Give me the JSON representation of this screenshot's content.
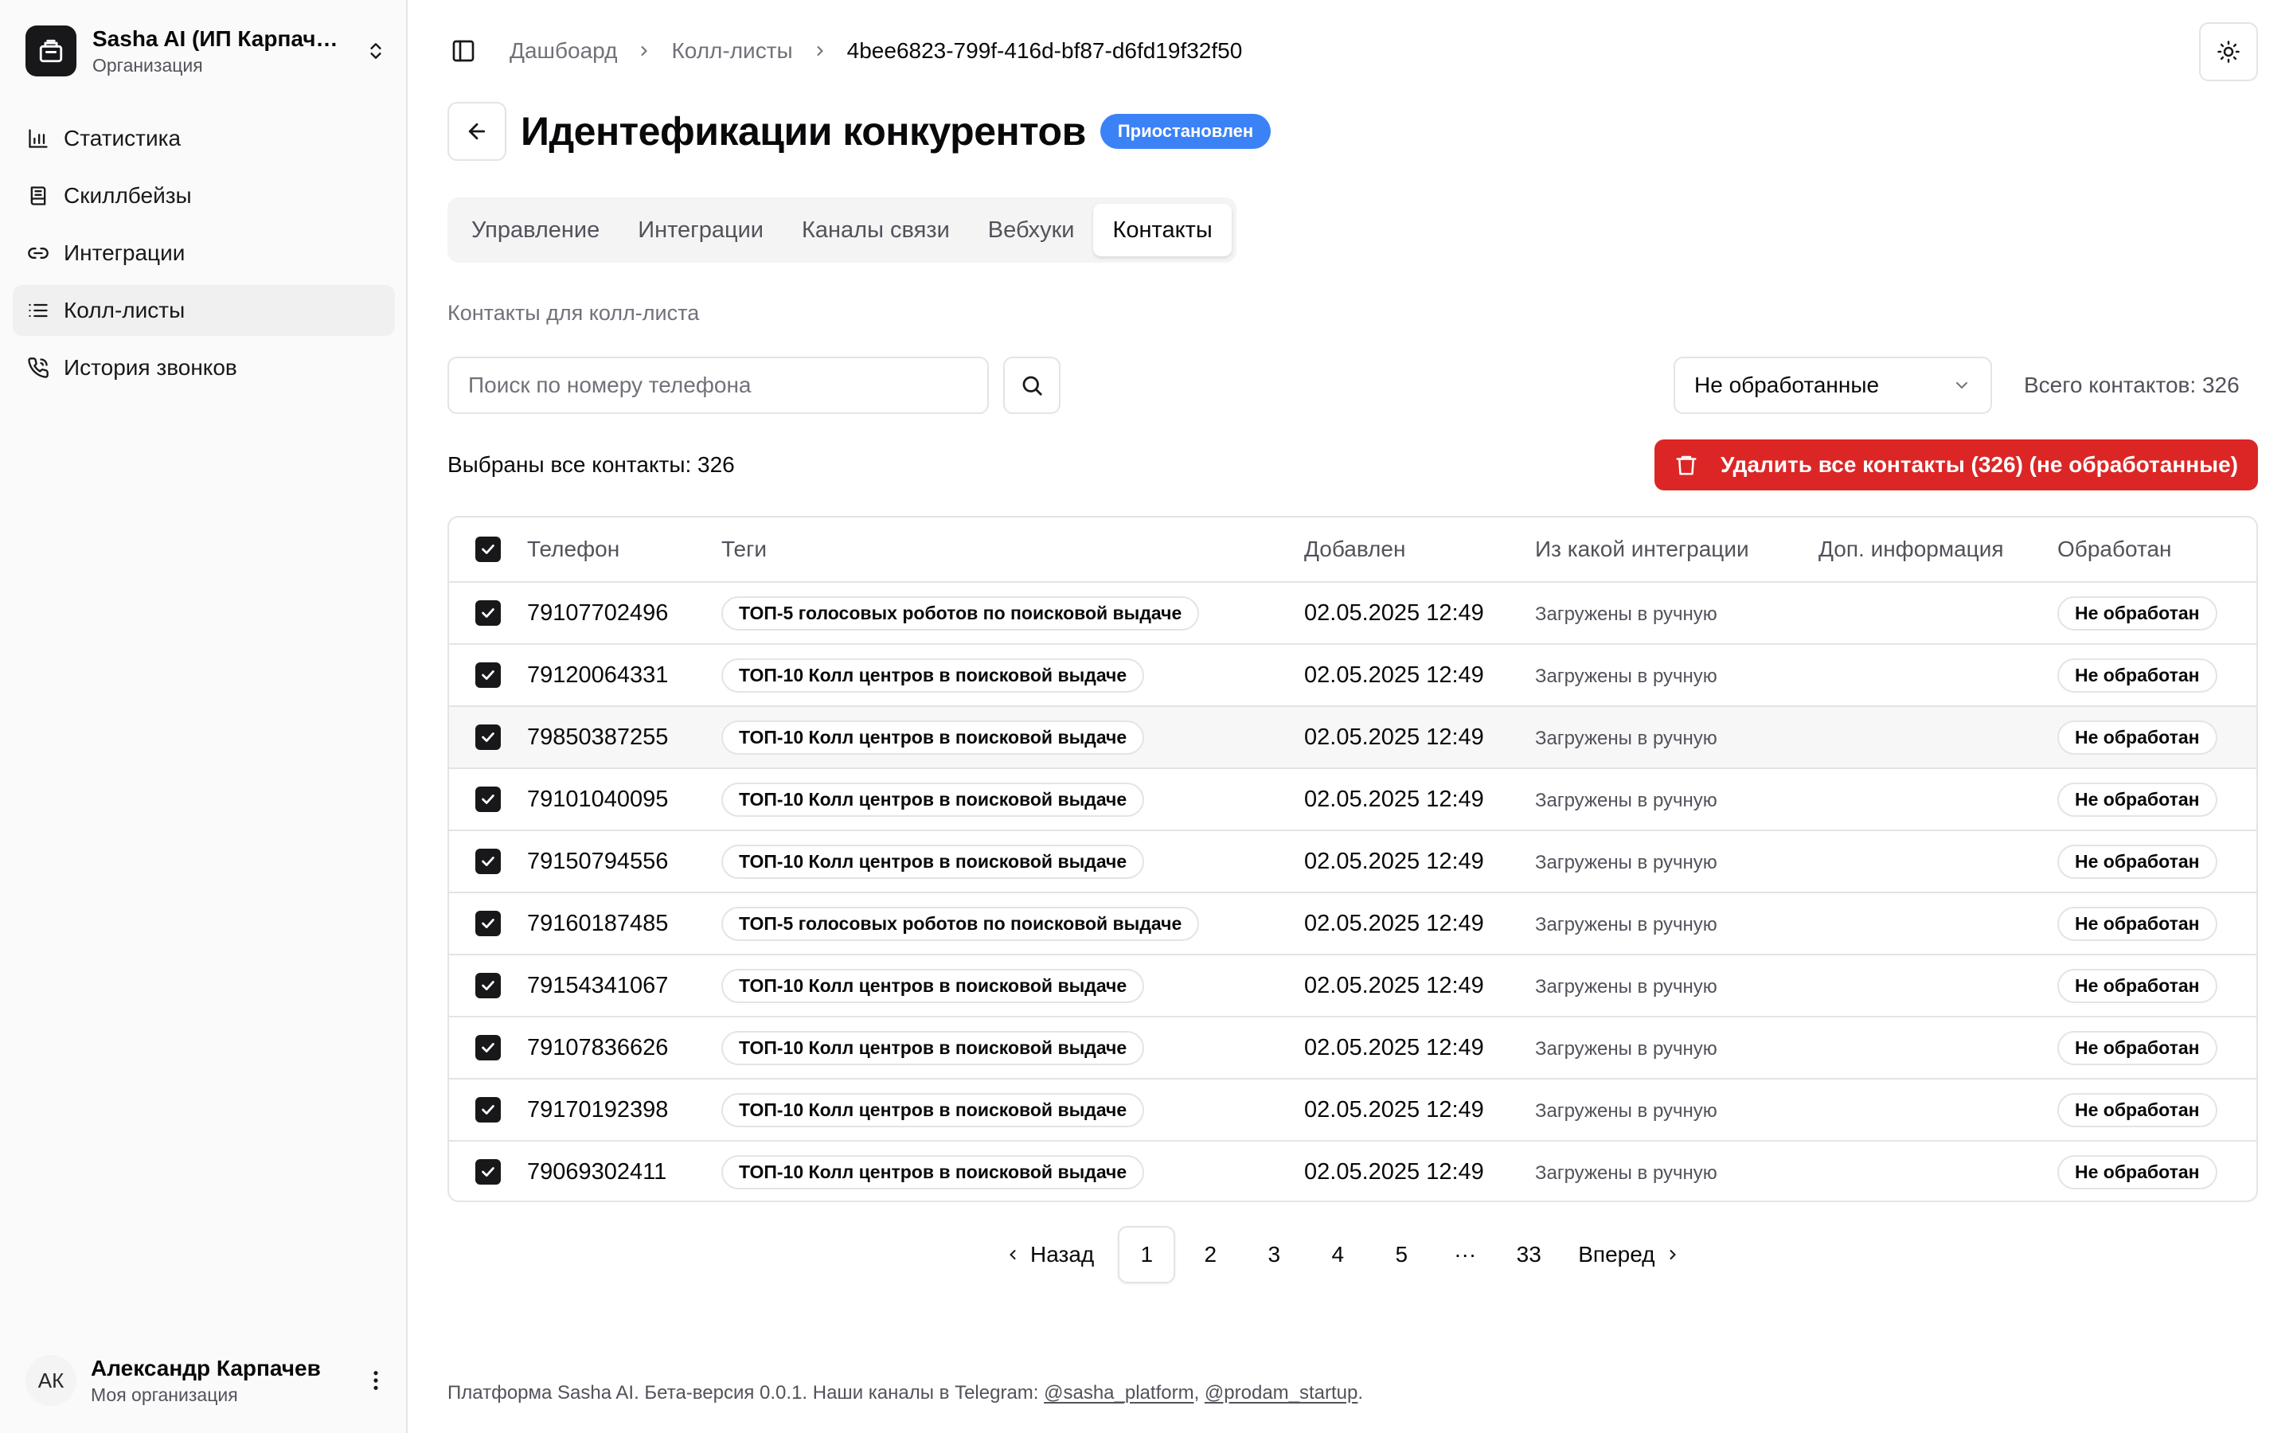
{
  "org": {
    "name": "Sasha AI (ИП Карпачев)",
    "subtitle": "Организация"
  },
  "nav": [
    {
      "label": "Статистика",
      "icon": "bar-chart-icon"
    },
    {
      "label": "Скиллбейзы",
      "icon": "book-icon"
    },
    {
      "label": "Интеграции",
      "icon": "link-icon"
    },
    {
      "label": "Колл-листы",
      "icon": "list-icon",
      "active": true
    },
    {
      "label": "История звонков",
      "icon": "phone-icon"
    }
  ],
  "user": {
    "initials": "АК",
    "name": "Александр Карпачев",
    "org": "Моя организация"
  },
  "breadcrumbs": {
    "item1": "Дашбоард",
    "item2": "Колл-листы",
    "current": "4bee6823-799f-416d-bf87-d6fd19f32f50"
  },
  "page": {
    "title": "Идентефикации конкурентов",
    "status": "Приостановлен"
  },
  "tabs": [
    "Управление",
    "Интеграции",
    "Каналы связи",
    "Вебхуки",
    "Контакты"
  ],
  "contacts": {
    "section_label": "Контакты для колл-листа",
    "search_placeholder": "Поиск по номеру телефона",
    "filter_value": "Не обработанные",
    "total_label": "Всего контактов: 326",
    "selected_label": "Выбраны все контакты: 326",
    "delete_label": "Удалить все контакты (326) (не обработанные)"
  },
  "table": {
    "headers": {
      "phone": "Телефон",
      "tags": "Теги",
      "added": "Добавлен",
      "source": "Из какой интеграции",
      "info": "Доп. информация",
      "processed": "Обработан"
    },
    "rows": [
      {
        "phone": "79107702496",
        "tag": "ТОП-5 голосовых роботов по поисковой выдаче",
        "added": "02.05.2025 12:49",
        "source": "Загружены в ручную",
        "info": "",
        "processed": "Не обработан"
      },
      {
        "phone": "79120064331",
        "tag": "ТОП-10 Колл центров в поисковой выдаче",
        "added": "02.05.2025 12:49",
        "source": "Загружены в ручную",
        "info": "",
        "processed": "Не обработан"
      },
      {
        "phone": "79850387255",
        "tag": "ТОП-10 Колл центров в поисковой выдаче",
        "added": "02.05.2025 12:49",
        "source": "Загружены в ручную",
        "info": "",
        "processed": "Не обработан"
      },
      {
        "phone": "79101040095",
        "tag": "ТОП-10 Колл центров в поисковой выдаче",
        "added": "02.05.2025 12:49",
        "source": "Загружены в ручную",
        "info": "",
        "processed": "Не обработан"
      },
      {
        "phone": "79150794556",
        "tag": "ТОП-10 Колл центров в поисковой выдаче",
        "added": "02.05.2025 12:49",
        "source": "Загружены в ручную",
        "info": "",
        "processed": "Не обработан"
      },
      {
        "phone": "79160187485",
        "tag": "ТОП-5 голосовых роботов по поисковой выдаче",
        "added": "02.05.2025 12:49",
        "source": "Загружены в ручную",
        "info": "",
        "processed": "Не обработан"
      },
      {
        "phone": "79154341067",
        "tag": "ТОП-10 Колл центров в поисковой выдаче",
        "added": "02.05.2025 12:49",
        "source": "Загружены в ручную",
        "info": "",
        "processed": "Не обработан"
      },
      {
        "phone": "79107836626",
        "tag": "ТОП-10 Колл центров в поисковой выдаче",
        "added": "02.05.2025 12:49",
        "source": "Загружены в ручную",
        "info": "",
        "processed": "Не обработан"
      },
      {
        "phone": "79170192398",
        "tag": "ТОП-10 Колл центров в поисковой выдаче",
        "added": "02.05.2025 12:49",
        "source": "Загружены в ручную",
        "info": "",
        "processed": "Не обработан"
      },
      {
        "phone": "79069302411",
        "tag": "ТОП-10 Колл центров в поисковой выдаче",
        "added": "02.05.2025 12:49",
        "source": "Загружены в ручную",
        "info": "",
        "processed": "Не обработан"
      }
    ]
  },
  "pagination": {
    "prev": "Назад",
    "next": "Вперед",
    "pages": [
      "1",
      "2",
      "3",
      "4",
      "5"
    ],
    "ellipsis": "···",
    "last": "33",
    "current": "1"
  },
  "footer": {
    "text": "Платформа Sasha AI. Бета-версия 0.0.1. Наши каналы в Telegram: ",
    "link1": "@sasha_platform",
    "sep": ", ",
    "link2": "@prodam_startup",
    "end": "."
  },
  "colors": {
    "accent_blue": "#3b82f6",
    "danger_red": "#dc2626",
    "dark": "#18181b"
  }
}
